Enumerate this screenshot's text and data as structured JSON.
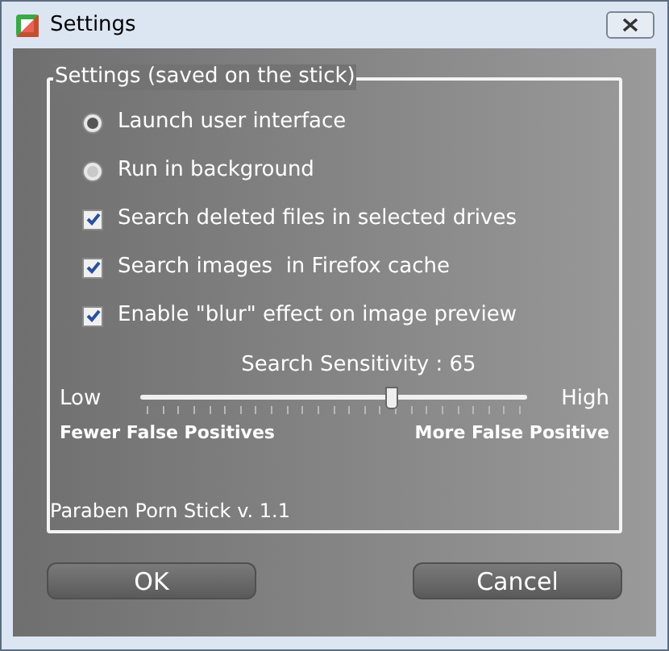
{
  "window": {
    "title": "Settings"
  },
  "group": {
    "title": "Settings (saved on the stick)",
    "options": [
      {
        "kind": "radio",
        "label": "Launch user interface",
        "selected": true
      },
      {
        "kind": "radio",
        "label": "Run in background",
        "selected": false
      },
      {
        "kind": "checkbox",
        "label": "Search deleted files in selected drives",
        "checked": true
      },
      {
        "kind": "checkbox",
        "label": "Search images  in Firefox cache",
        "checked": true
      },
      {
        "kind": "checkbox",
        "label": "Enable \"blur\" effect on image preview",
        "checked": true
      }
    ],
    "slider": {
      "label": "Search Sensitivity : 65",
      "min_label": "Low",
      "max_label": "High",
      "level": 0.65,
      "left_caption": "Fewer False Positives",
      "right_caption": "More False Positive"
    },
    "version": "Paraben Porn Stick v. 1.1"
  },
  "buttons": [
    "OK",
    "Cancel"
  ]
}
